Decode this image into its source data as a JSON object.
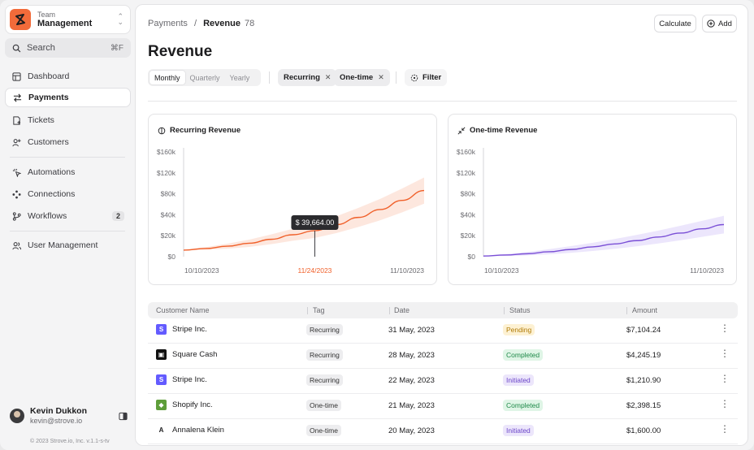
{
  "sidebar": {
    "team_label": "Team",
    "team_name": "Management",
    "search_label": "Search",
    "search_shortcut": "⌘F",
    "items": [
      {
        "label": "Dashboard",
        "icon": "dashboard-icon"
      },
      {
        "label": "Payments",
        "icon": "payments-icon",
        "active": true
      },
      {
        "label": "Tickets",
        "icon": "tickets-icon"
      },
      {
        "label": "Customers",
        "icon": "customers-icon"
      },
      {
        "label": "Automations",
        "icon": "automations-icon"
      },
      {
        "label": "Connections",
        "icon": "connections-icon"
      },
      {
        "label": "Workflows",
        "icon": "workflows-icon",
        "badge": "2"
      },
      {
        "label": "User Management",
        "icon": "user-management-icon"
      }
    ],
    "user_name": "Kevin Dukkon",
    "user_email": "kevin@strove.io",
    "footer": "© 2023 Strove.io, Inc. v.1.1-s-tv"
  },
  "header": {
    "breadcrumb_parent": "Payments",
    "breadcrumb_sep": "/",
    "breadcrumb_current": "Revenue",
    "breadcrumb_count": "78",
    "calculate_label": "Calculate",
    "add_label": "Add",
    "page_title": "Revenue"
  },
  "toolbar": {
    "periods": [
      "Monthly",
      "Quarterly",
      "Yearly"
    ],
    "active_period": "Monthly",
    "chips": [
      "Recurring",
      "One-time"
    ],
    "chip_remove": "✕",
    "filter_label": "Filter"
  },
  "chart_data": [
    {
      "type": "line",
      "title": "Recurring Revenue",
      "y_ticks": [
        "$160k",
        "$120k",
        "$80k",
        "$40k",
        "$20k",
        "$0"
      ],
      "x_ticks": [
        "10/10/2023",
        "11/24/2023",
        "11/10/2023"
      ],
      "ylim": [
        0,
        160000
      ],
      "series": [
        {
          "values": [
            10000,
            12500,
            16000,
            20500,
            26500,
            33500,
            39664,
            49000,
            60000,
            72000,
            86000,
            101000
          ]
        }
      ],
      "band_spread": [
        600,
        2000,
        3800,
        5600,
        7400,
        9200,
        11000,
        12800,
        14600,
        16400,
        18200,
        20000
      ],
      "tooltip": "$ 39,664.00",
      "tooltip_index": 6,
      "highlight_x_tick": "11/24/2023",
      "color": "#f0602a",
      "band_color": "#fde3d8"
    },
    {
      "type": "line",
      "title": "One-time Revenue",
      "y_ticks": [
        "$160k",
        "$120k",
        "$80k",
        "$40k",
        "$20k",
        "$0"
      ],
      "x_ticks": [
        "10/10/2023",
        "11/10/2023"
      ],
      "ylim": [
        0,
        160000
      ],
      "series": [
        {
          "values": [
            1000,
            2500,
            4500,
            7500,
            11000,
            15000,
            19500,
            24500,
            30000,
            36000,
            42500,
            49000
          ]
        }
      ],
      "band_spread": [
        300,
        1500,
        2700,
        3900,
        5100,
        6300,
        7500,
        8700,
        9900,
        11100,
        12300,
        13500
      ],
      "color": "#7a4fd6",
      "band_color": "#e9e2fb"
    }
  ],
  "table": {
    "columns": [
      "Customer Name",
      "Tag",
      "Date",
      "Status",
      "Amount"
    ],
    "rows": [
      {
        "customer": "Stripe Inc.",
        "logo": "S",
        "logo_bg": "#635bff",
        "tag": "Recurring",
        "date": "31 May, 2023",
        "status": "Pending",
        "status_bg": "#fdf1d3",
        "status_fg": "#b07a05",
        "amount": "$7,104.24"
      },
      {
        "customer": "Square Cash",
        "logo": "▣",
        "logo_bg": "#111111",
        "tag": "Recurring",
        "date": "28 May, 2023",
        "status": "Completed",
        "status_bg": "#dff5e6",
        "status_fg": "#1f8a49",
        "amount": "$4,245.19"
      },
      {
        "customer": "Stripe Inc.",
        "logo": "S",
        "logo_bg": "#635bff",
        "tag": "Recurring",
        "date": "22 May, 2023",
        "status": "Initiated",
        "status_bg": "#ece6fb",
        "status_fg": "#6b45c9",
        "amount": "$1,210.90"
      },
      {
        "customer": "Shopify Inc.",
        "logo": "◆",
        "logo_bg": "#5e9e3a",
        "tag": "One-time",
        "date": "21 May, 2023",
        "status": "Completed",
        "status_bg": "#dff5e6",
        "status_fg": "#1f8a49",
        "amount": "$2,398.15"
      },
      {
        "customer": "Annalena Klein",
        "logo": "A",
        "logo_bg": "#ffffff",
        "tag": "One-time",
        "date": "20 May, 2023",
        "status": "Initiated",
        "status_bg": "#ece6fb",
        "status_fg": "#6b45c9",
        "amount": "$1,600.00"
      }
    ],
    "row_menu": "⋮"
  }
}
